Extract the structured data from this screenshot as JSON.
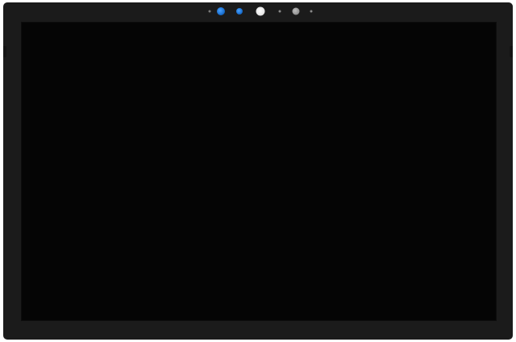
{
  "device": {
    "type": "tablet-display",
    "bezel_color": "#1b1b1b",
    "screen_color": "#050505",
    "screen_state": "off"
  },
  "sensors": [
    {
      "name": "indicator-dot",
      "color": "#7a7a7a"
    },
    {
      "name": "ir-sensor",
      "color": "#1a6fcf"
    },
    {
      "name": "ir-sensor",
      "color": "#1a6fcf"
    },
    {
      "name": "front-camera",
      "color": "#e6e6e6"
    },
    {
      "name": "indicator-dot",
      "color": "#8a8a8a"
    },
    {
      "name": "ambient-light-sensor",
      "color": "#8e8e8e"
    },
    {
      "name": "indicator-dot",
      "color": "#8a8a8a"
    }
  ]
}
